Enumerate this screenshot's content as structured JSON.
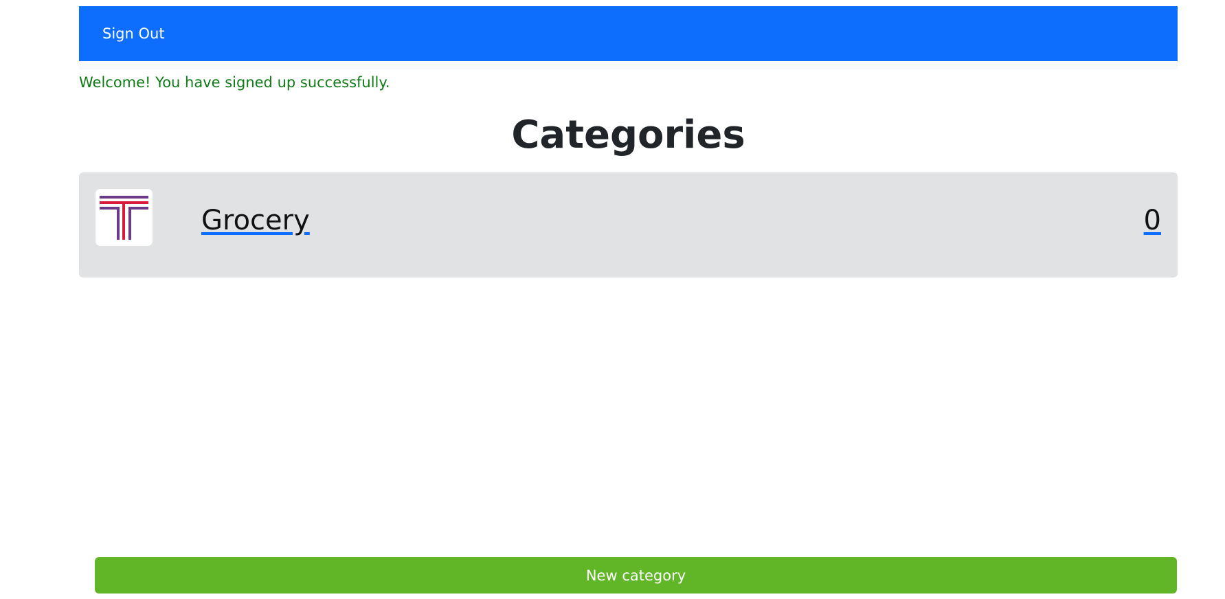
{
  "nav": {
    "sign_out_label": "Sign Out"
  },
  "flash": {
    "notice": "Welcome! You have signed up successfully."
  },
  "page": {
    "title": "Categories"
  },
  "categories": [
    {
      "name": "Grocery",
      "total": "0",
      "icon": "category-logo-t"
    }
  ],
  "actions": {
    "new_category_label": "New category"
  },
  "colors": {
    "navbar": "#0d6efd",
    "notice_text": "#0f7a16",
    "card_background": "#e1e2e4",
    "button_background": "#61b627"
  }
}
